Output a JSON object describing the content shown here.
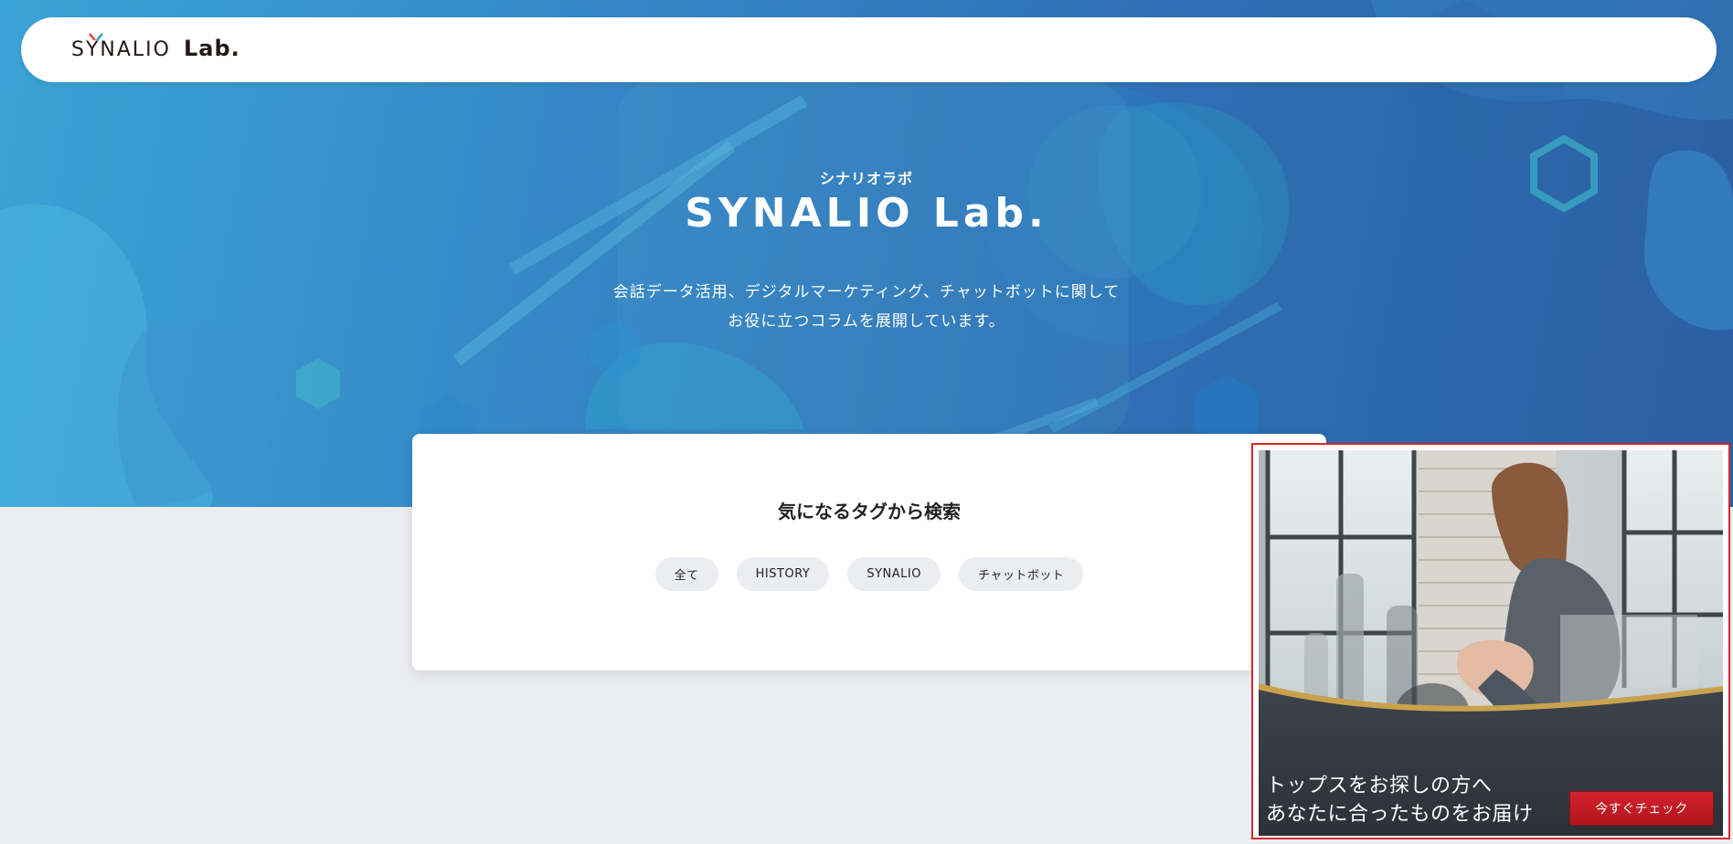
{
  "header": {
    "logo_synalio": "SYNALIO",
    "logo_lab": "Lab."
  },
  "hero": {
    "kana": "シナリオラボ",
    "title": "SYNALIO Lab.",
    "desc_line1": "会話データ活用、デジタルマーケティング、チャットボットに関して",
    "desc_line2": "お役に立つコラムを展開しています。"
  },
  "tag_search": {
    "heading": "気になるタグから検索",
    "tags": [
      "全て",
      "HISTORY",
      "SYNALIO",
      "チャットボット"
    ]
  },
  "ad": {
    "line1": "トップスをお探しの方へ",
    "line2": "あなたに合ったものをお届け",
    "button": "今すぐチェック"
  },
  "colors": {
    "hero_blue": "#3586c4",
    "ad_border": "#d9252a",
    "ad_button": "#c81d25",
    "page_bg": "#ecedf1"
  }
}
